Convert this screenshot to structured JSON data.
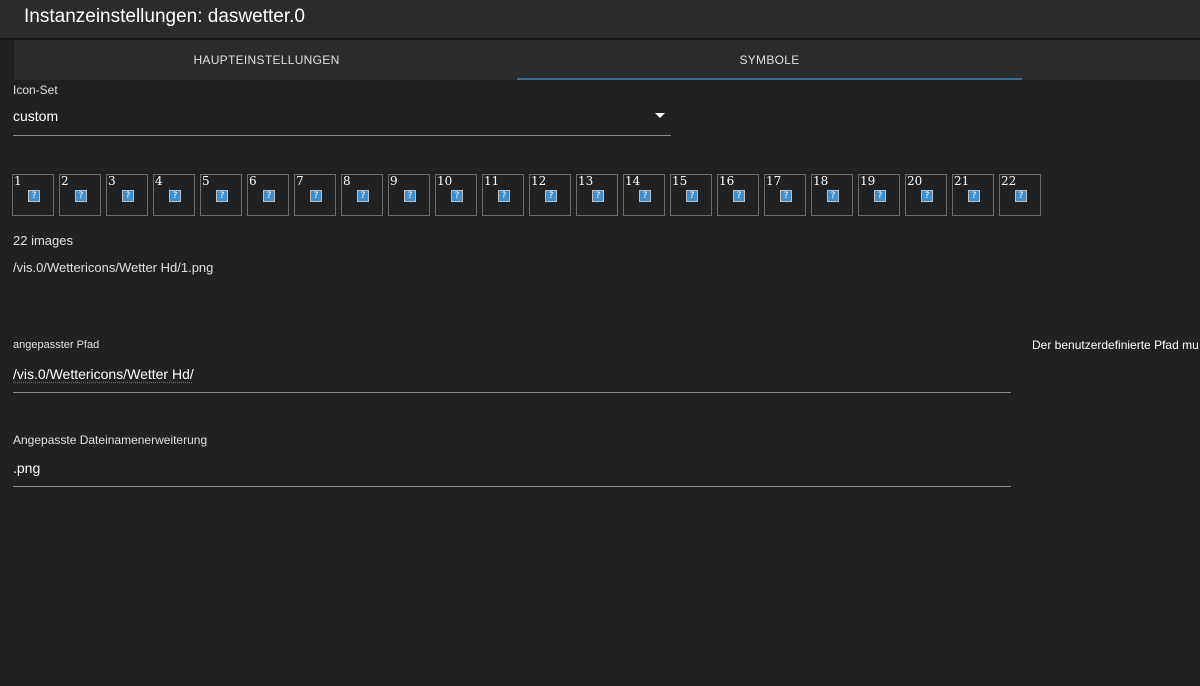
{
  "window": {
    "title": "Instanzeinstellungen: daswetter.0"
  },
  "tabs": [
    {
      "label": "HAUPTEINSTELLUNGEN",
      "active": false
    },
    {
      "label": "SYMBOLE",
      "active": true
    }
  ],
  "icon_set": {
    "label": "Icon-Set",
    "value": "custom"
  },
  "icons": {
    "numbers": [
      "1",
      "2",
      "3",
      "4",
      "5",
      "6",
      "7",
      "8",
      "9",
      "10",
      "11",
      "12",
      "13",
      "14",
      "15",
      "16",
      "17",
      "18",
      "19",
      "20",
      "21",
      "22"
    ],
    "placeholder_glyph": "?"
  },
  "image_count": "22 images",
  "sample_path": "/vis.0/Wettericons/Wetter Hd/1.png",
  "custom_path": {
    "label": "angepasster Pfad",
    "value": "/vis.0/Wettericons/Wetter Hd/"
  },
  "extension": {
    "label": "Angepasste Dateinamenerweiterung",
    "value": ".png"
  },
  "helper_text": "Der benutzerdefinierte Pfad mu",
  "colors": {
    "tab_indicator": "#3b6f93",
    "background": "#212121",
    "bar": "#2b2b2b"
  }
}
